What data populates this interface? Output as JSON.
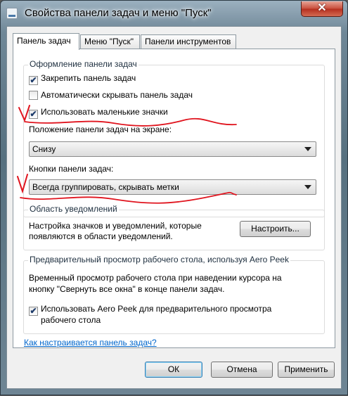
{
  "window": {
    "title": "Свойства панели задач и меню \"Пуск\"",
    "close_label": "✕"
  },
  "tabs": [
    {
      "label": "Панель задач",
      "active": true
    },
    {
      "label": "Меню \"Пуск\"",
      "active": false
    },
    {
      "label": "Панели инструментов",
      "active": false
    }
  ],
  "taskbar_group": {
    "title": "Оформление панели задач",
    "lock_label": "Закрепить панель задач",
    "lock_checked": true,
    "autohide_label": "Автоматически скрывать панель задач",
    "autohide_checked": false,
    "small_icons_label": "Использовать маленькие значки",
    "small_icons_checked": true,
    "position_label": "Положение панели задач на экране:",
    "position_value": "Снизу",
    "buttons_label": "Кнопки панели задач:",
    "buttons_value": "Всегда группировать, скрывать метки"
  },
  "notification_group": {
    "title": "Область уведомлений",
    "description": [
      "Настройка значков и уведомлений, которые",
      "появляются в области уведомлений."
    ],
    "customize_button": "Настроить..."
  },
  "peek_group": {
    "title": "Предварительный просмотр рабочего стола, используя Aero Peek",
    "description": [
      "Временный просмотр рабочего стола при наведении курсора на",
      "кнопку \"Свернуть все окна\" в конце панели задач."
    ],
    "peek_label": [
      "Использовать Aero Peek для предварительного просмотра",
      "рабочего стола"
    ],
    "peek_checked": true
  },
  "help_link": "Как настраивается панель задач?",
  "footer": {
    "ok": "ОК",
    "cancel": "Отмена",
    "apply": "Применить"
  },
  "colors": {
    "annotation": "#e0141e",
    "link": "#0066cc",
    "close_button": "#c9503e"
  },
  "icons": {
    "window": "taskbar-window-icon",
    "checkmark": "✔",
    "combo": "dropdown-triangle-icon"
  }
}
